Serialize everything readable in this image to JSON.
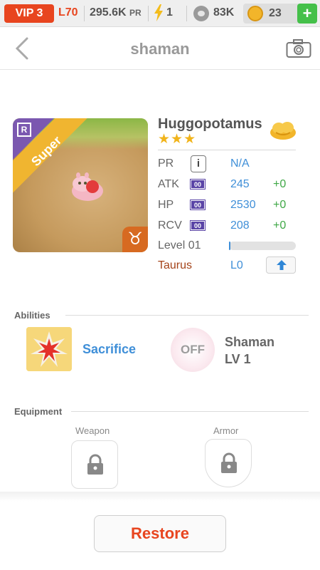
{
  "status_bar": {
    "vip": "VIP 3",
    "level": "L70",
    "pr_value": "295.6K",
    "pr_label": "PR",
    "energy": "1",
    "food": "83K",
    "coins": "23",
    "add_label": "+"
  },
  "nav": {
    "title": "shaman"
  },
  "pet": {
    "name": "Huggopotamus",
    "stars": "★★★",
    "rarity_tag": "Super",
    "rarity_icon": "R",
    "zodiac_symbol": "♉",
    "level_progress": 0.02,
    "stats": {
      "pr": {
        "label": "PR",
        "badge": "i",
        "value": "N/A"
      },
      "atk": {
        "label": "ATK",
        "badge": "00",
        "value": "245",
        "bonus": "+0"
      },
      "hp": {
        "label": "HP",
        "badge": "00",
        "value": "2530",
        "bonus": "+0"
      },
      "rcv": {
        "label": "RCV",
        "badge": "00",
        "value": "208",
        "bonus": "+0"
      },
      "level": {
        "label": "Level 01"
      },
      "zodiac": {
        "label": "Taurus",
        "value": "L0"
      }
    }
  },
  "abilities": {
    "title": "Abilities",
    "active": {
      "name": "Sacrifice"
    },
    "passive": {
      "state": "OFF",
      "name": "Shaman",
      "level": "LV 1"
    }
  },
  "equipment": {
    "title": "Equipment",
    "weapon_label": "Weapon",
    "armor_label": "Armor"
  },
  "footer": {
    "restore_label": "Restore"
  },
  "colors": {
    "accent_red": "#e8451f",
    "stat_blue": "#3f8fd8",
    "bonus_green": "#3fa846",
    "zodiac_brown": "#a4431a",
    "star_gold": "#f1b41b"
  }
}
